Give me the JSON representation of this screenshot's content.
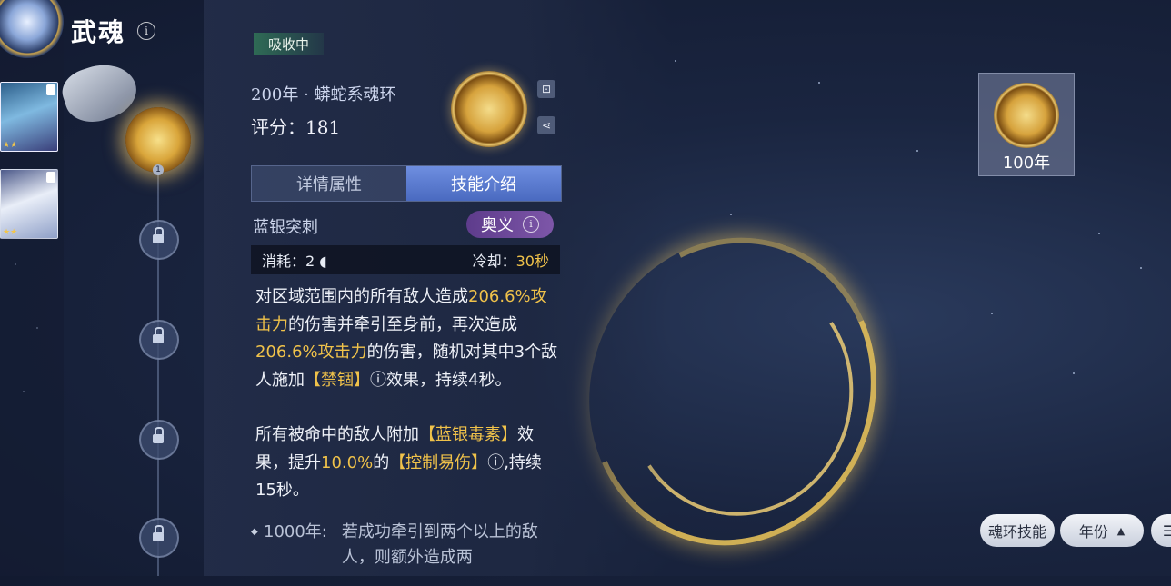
{
  "header": {
    "title": "武魂"
  },
  "panel": {
    "status_tag": "吸收中",
    "ring_name": "200年 · 蟒蛇系魂环",
    "score_label": "评分：181",
    "tabs": [
      {
        "label": "详情属性",
        "active": false
      },
      {
        "label": "技能介绍",
        "active": true
      }
    ],
    "skill": {
      "name": "蓝银突刺",
      "type_badge": "奥义",
      "cost_label": "消耗：2",
      "cooldown_label": "冷却：",
      "cooldown_value": "30秒"
    },
    "description": {
      "p1": [
        {
          "t": "对区域范围内的所有敌人造成",
          "h": false
        },
        {
          "t": "206.6%攻击力",
          "h": true
        },
        {
          "t": "的伤害并牵引至身前，再次造成",
          "h": false
        },
        {
          "t": "206.6%攻击力",
          "h": true
        },
        {
          "t": "的伤害，随机对其中3个敌人施加",
          "h": false
        },
        {
          "t": "【禁锢】",
          "h": true
        },
        {
          "t": "ⓘ",
          "h": false
        },
        {
          "t": "效果，持续4秒。",
          "h": false
        }
      ],
      "p2": [
        {
          "t": "所有被命中的敌人附加",
          "h": false
        },
        {
          "t": "【蓝银毒素】",
          "h": true
        },
        {
          "t": "效果，提升",
          "h": false
        },
        {
          "t": "10.0%",
          "h": true
        },
        {
          "t": "的",
          "h": false
        },
        {
          "t": "【控制易伤】",
          "h": true
        },
        {
          "t": "ⓘ",
          "h": false
        },
        {
          "t": ",持续15秒。",
          "h": false
        }
      ]
    },
    "upgrade_note": {
      "year": "1000年:",
      "text": "若成功牵引到两个以上的敌人，则额外造成两"
    }
  },
  "left": {
    "ring_slot_number": "1"
  },
  "right": {
    "ring_card_year": "100年",
    "buttons": {
      "ring_skill": "魂环技能",
      "year_sort": "年份",
      "year_sort_arrow": "▲",
      "menu": "☰"
    }
  },
  "colors": {
    "highlight": "#f0c24a",
    "tab_active": "#5a7ad0",
    "ultimate_badge": "#6a4896"
  }
}
